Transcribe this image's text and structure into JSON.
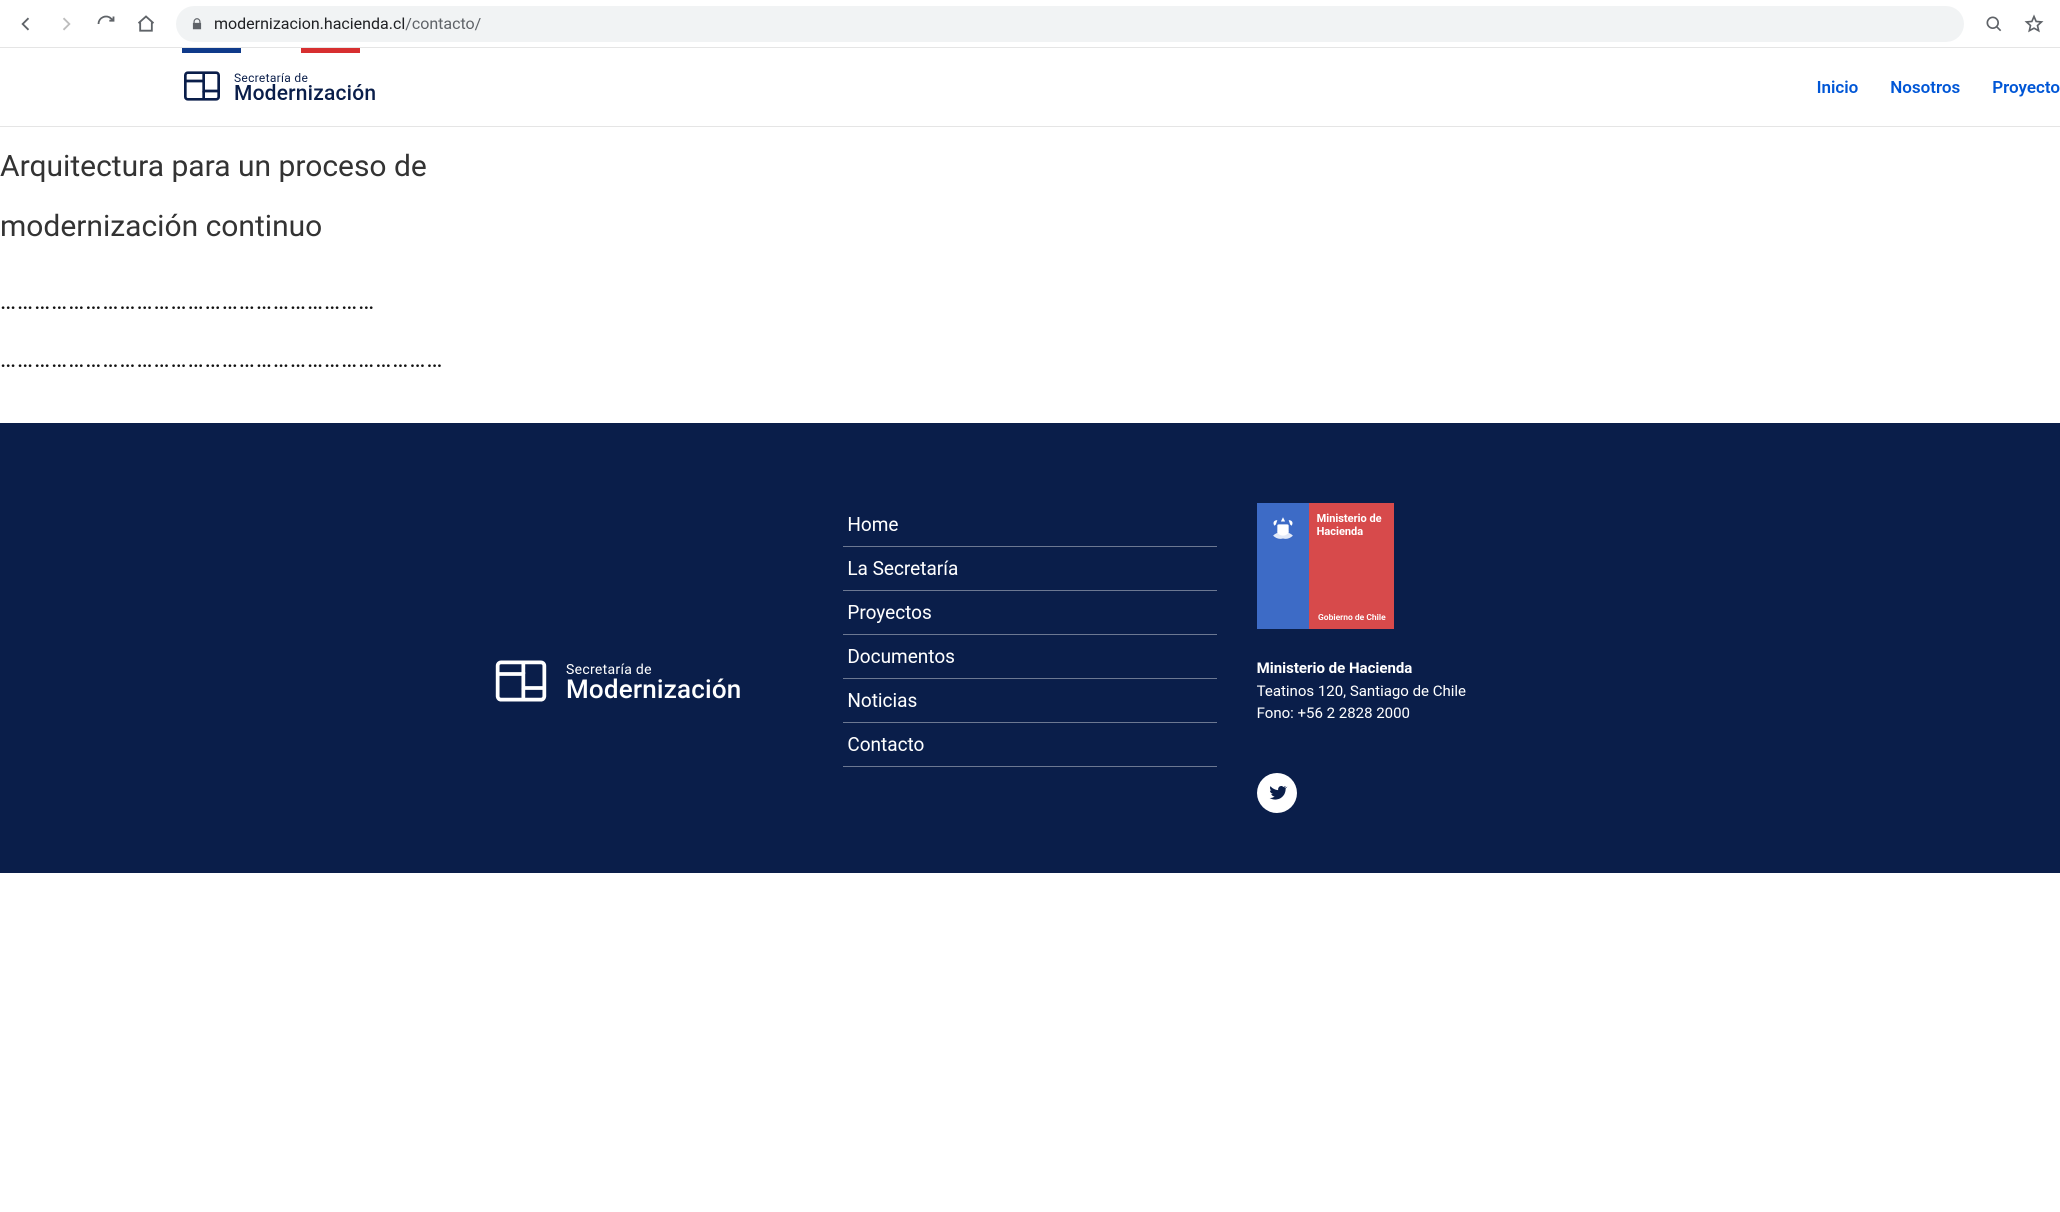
{
  "browser": {
    "url_domain": "modernizacion.hacienda.cl",
    "url_path": "/contacto/"
  },
  "header": {
    "logo_line1": "Secretaría de",
    "logo_line2": "Modernización",
    "nav": [
      "Inicio",
      "Nosotros",
      "Proyecto"
    ]
  },
  "content": {
    "heading_line1": "Arquitectura para un proceso de",
    "heading_line2": "modernización continuo",
    "dotline1": "…………………………………………………………",
    "dotline2": "……………………………………………………………………"
  },
  "footer": {
    "logo_line1": "Secretaría de",
    "logo_line2": "Modernización",
    "links": [
      "Home",
      "La Secretaría",
      "Proyectos",
      "Documentos",
      "Noticias",
      "Contacto"
    ],
    "gob_logo_top": "Ministerio de\nHacienda",
    "gob_logo_bottom": "Gobierno de Chile",
    "contact_title": "Ministerio de Hacienda",
    "contact_address": "Teatinos 120, Santiago de Chile",
    "contact_phone": "Fono: +56 2 2828 2000"
  }
}
